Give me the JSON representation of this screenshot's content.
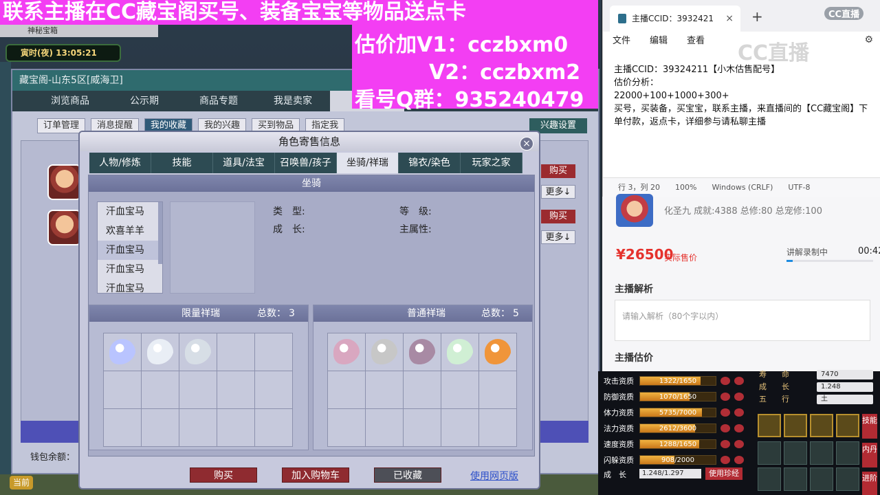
{
  "banner": {
    "top": "联系主播在CC藏宝阁买号、装备宝宝等物品送点卡",
    "v1": "估价加V1：cczbxm0",
    "v2": "V2：cczbxm2",
    "qq": "看号Q群：935240479"
  },
  "game": {
    "tab": "神秘宝箱",
    "time": "寅时(夜) 13:05:21",
    "now_button": "当前",
    "wallet_label": "钱包余额：",
    "avatar_ids": [
      "player-avatar-1",
      "player-avatar-2"
    ]
  },
  "treasure_window": {
    "title": "藏宝阁-山东5区[威海卫]",
    "nav": [
      "浏览商品",
      "公示期",
      "商品专题",
      "我是卖家",
      "我"
    ],
    "nav_active_index": 4,
    "subnav": [
      "订单管理",
      "消息提醒",
      "我的收藏",
      "我的兴趣",
      "买到物品",
      "指定我"
    ],
    "subnav_active_index": 2,
    "setting": "兴趣设置",
    "rows": [
      {
        "buy": "购买",
        "more": "更多↓"
      },
      {
        "buy": "购买",
        "more": "更多↓"
      }
    ]
  },
  "modal": {
    "title": "角色寄售信息",
    "close": "×",
    "tabs": [
      "人物/修炼",
      "技能",
      "道具/法宝",
      "召唤兽/孩子",
      "坐骑/祥瑞",
      "锦衣/染色",
      "玩家之家"
    ],
    "active_tab": 4,
    "section": "坐骑",
    "mounts": [
      "汗血宝马",
      "欢喜羊羊",
      "汗血宝马",
      "汗血宝马",
      "汗血宝马"
    ],
    "selected_mount": 2,
    "attrs": {
      "type_label": "类　型:",
      "growth_label": "成　长:",
      "level_label": "等　级:",
      "main_attr_label": "主属性:"
    },
    "limited": {
      "title": "限量祥瑞",
      "count_label": "总数：",
      "count": "3"
    },
    "normal": {
      "title": "普通祥瑞",
      "count_label": "总数：",
      "count": "5"
    },
    "limited_pets": [
      "#b9c4ff",
      "#e9eef5",
      "#d7dee6"
    ],
    "normal_pets": [
      "#d9a7c0",
      "#c7c7c7",
      "#a88aa4",
      "#d0efd4",
      "#f0953a"
    ],
    "buttons": {
      "buy": "购买",
      "cart": "加入购物车",
      "fav": "已收藏",
      "web": "使用网页版"
    }
  },
  "notepad": {
    "tab_title": "主播CCID：3932421",
    "close": "×",
    "plus": "+",
    "logo": "CC直播",
    "watermark": "CC直播",
    "menu": [
      "文件",
      "编辑",
      "查看"
    ],
    "content": "主播CCID：39324211【小木估售配号】\n估价分析：\n22000+100+1000+300+\n买号，买装备，买宝宝，联系主播，来直播间的【CC藏宝阁】下单付款，返点卡，详细参与请私聊主播",
    "status": [
      "行 3，列 20",
      "100%",
      "Windows (CRLF)",
      "UTF-8"
    ]
  },
  "seller": {
    "meta": "化圣九 成就:4388 总修:80 总宠修:100",
    "price": "¥26500",
    "price_label": "实际售价",
    "recording": "讲解录制中",
    "time": "00:42",
    "progress": 0.07,
    "analysis_title": "主播解析",
    "analysis_placeholder": "请输入解析（80个字以内）",
    "estimate_title": "主播估价"
  },
  "stats": {
    "rows": [
      {
        "label": "攻击资质",
        "value": "1322/1650",
        "fill": 0.8
      },
      {
        "label": "防御资质",
        "value": "1070/1650",
        "fill": 0.65
      },
      {
        "label": "体力资质",
        "value": "5735/7000",
        "fill": 0.82
      },
      {
        "label": "法力资质",
        "value": "2612/3600",
        "fill": 0.73
      },
      {
        "label": "速度资质",
        "value": "1288/1650",
        "fill": 0.78
      },
      {
        "label": "闪躲资质",
        "value": "908/2000",
        "fill": 0.45
      }
    ],
    "info": [
      {
        "label": "寿　　命",
        "value": "7470"
      },
      {
        "label": "成　　长",
        "value": "1.248"
      },
      {
        "label": "五　　行",
        "value": "土"
      }
    ],
    "growth_label": "成　长",
    "growth_value": "1.248/1.297",
    "zhen_button": "使用珍经",
    "side_buttons": [
      "技能",
      "内丹",
      "进阶"
    ]
  }
}
